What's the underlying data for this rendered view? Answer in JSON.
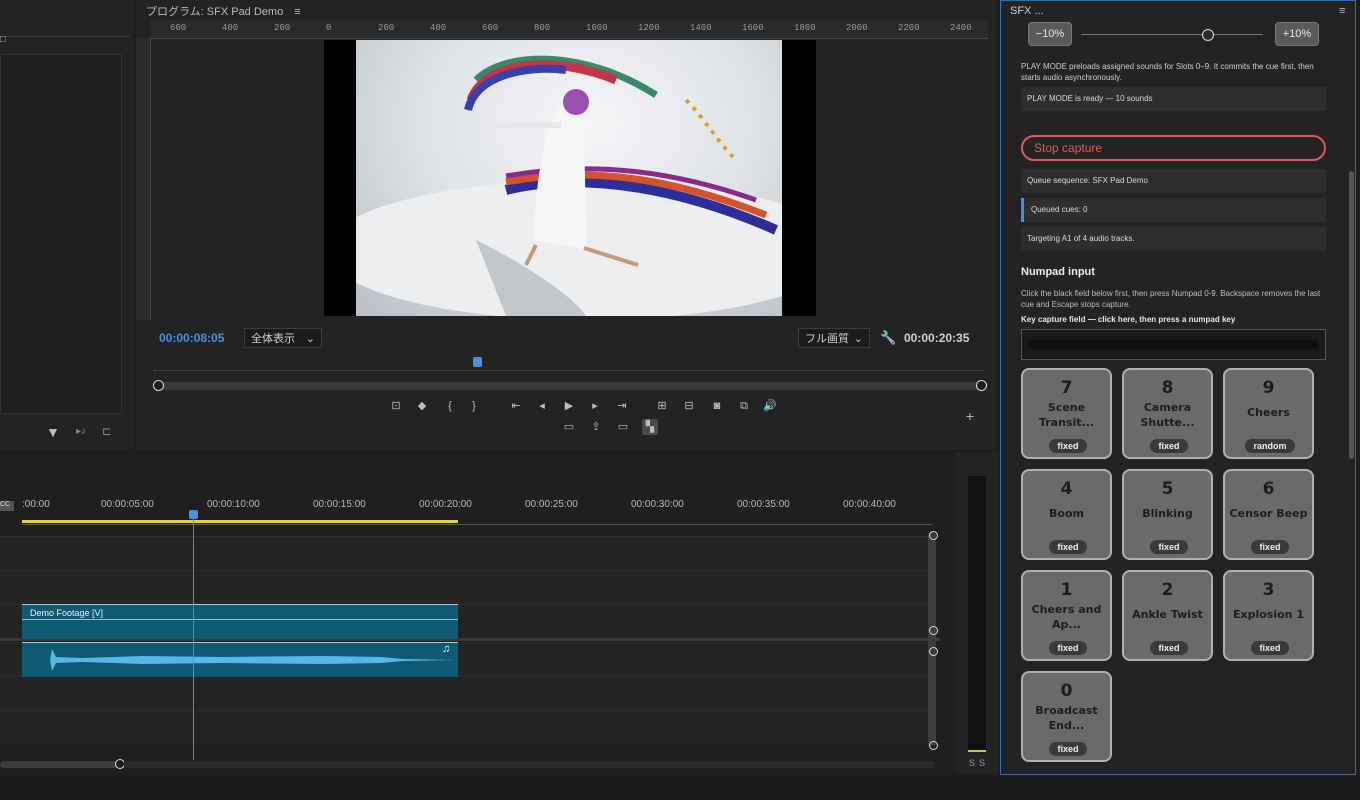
{
  "program": {
    "title": "プログラム: SFX Pad Demo",
    "ruler_labels": [
      "600",
      "400",
      "200",
      "0",
      "200",
      "400",
      "600",
      "800",
      "1000",
      "1200",
      "1400",
      "1600",
      "1800",
      "2000",
      "2200",
      "2400"
    ],
    "current_time": "00:00:08:05",
    "zoom_select": "全体表示",
    "quality_select": "フル画質",
    "duration": "00:00:20:35",
    "playhead_fraction": 0.41
  },
  "timeline": {
    "ruler_labels": [
      ":00:00",
      "00:00:05:00",
      "00:00:10:00",
      "00:00:15:00",
      "00:00:20:00",
      "00:00:25:00",
      "00:00:30:00",
      "00:00:35:00",
      "00:00:40:00"
    ],
    "video_clip": "Demo Footage [V]",
    "audio_note": "♫",
    "meter_labels": [
      "S",
      "S"
    ]
  },
  "sfx": {
    "title": "SFX ...",
    "minus_label": "−10%",
    "plus_label": "+10%",
    "play_mode_desc": "PLAY MODE preloads assigned sounds for Slots 0–9. It commits the cue first, then starts audio asynchronously.",
    "play_mode_status": "PLAY MODE is ready — 10 sounds",
    "stop_label": "Stop capture",
    "queue_sequence": "Queue sequence: SFX Pad Demo",
    "queued_cues": "Queued cues: 0",
    "targeting": "Targeting A1 of 4 audio tracks.",
    "numpad_heading": "Numpad input",
    "numpad_desc": "Click the black field below first, then press Numpad 0-9. Backspace removes the last cue and Escape stops capture.",
    "capture_label": "Key capture field — click here, then press a numpad key",
    "pads": [
      {
        "num": "7",
        "name": "Scene Transit...",
        "mode": "fixed"
      },
      {
        "num": "8",
        "name": "Camera Shutte...",
        "mode": "fixed"
      },
      {
        "num": "9",
        "name": "Cheers",
        "mode": "random"
      },
      {
        "num": "4",
        "name": "Boom",
        "mode": "fixed"
      },
      {
        "num": "5",
        "name": "Blinking",
        "mode": "fixed"
      },
      {
        "num": "6",
        "name": "Censor Beep",
        "mode": "fixed"
      },
      {
        "num": "1",
        "name": "Cheers and Ap...",
        "mode": "fixed"
      },
      {
        "num": "2",
        "name": "Ankle Twist",
        "mode": "fixed"
      },
      {
        "num": "3",
        "name": "Explosion 1",
        "mode": "fixed"
      },
      {
        "num": "0",
        "name": "Broadcast End...",
        "mode": "fixed"
      }
    ]
  },
  "colors": {
    "accent_blue": "#4a90e2",
    "stop_red": "#e05a5a",
    "clip_teal": "#0f5a73",
    "waveform": "#56b6e8"
  }
}
